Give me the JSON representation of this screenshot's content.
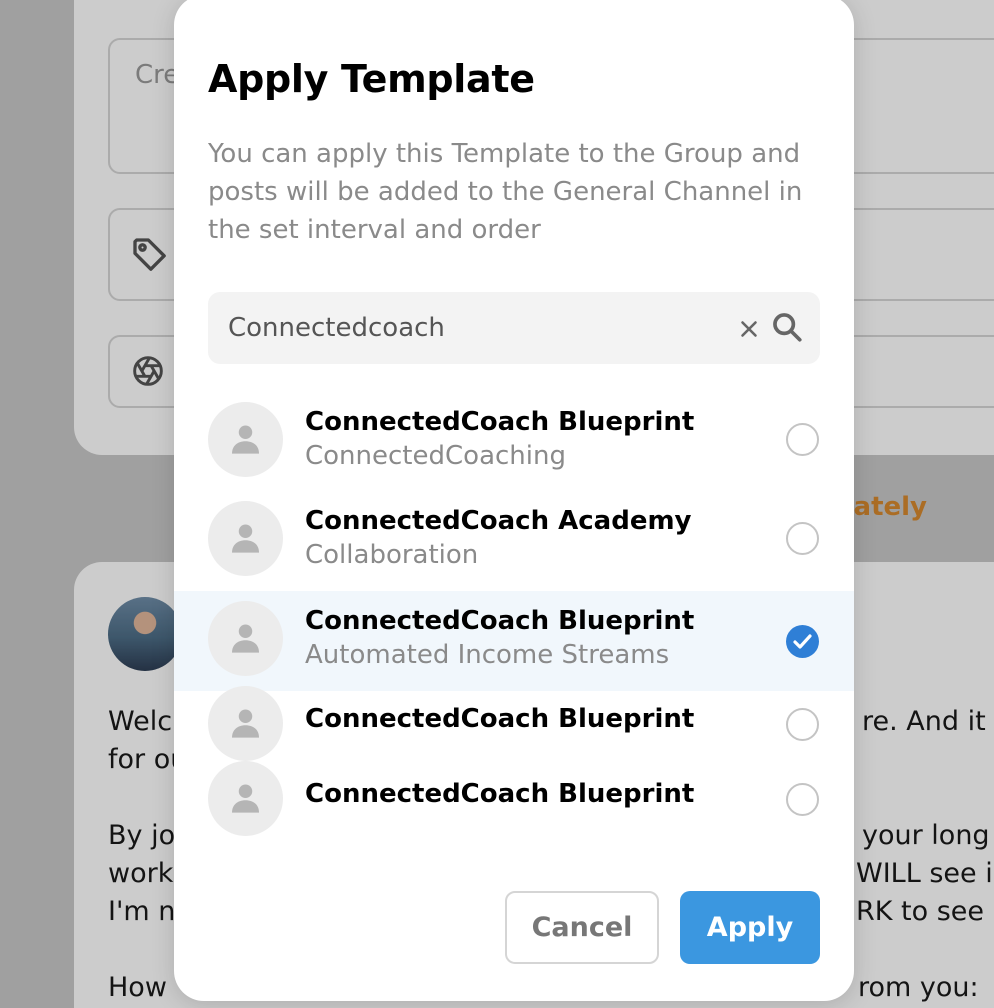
{
  "background": {
    "create_placeholder": "Cre",
    "orange_text": "diately",
    "post_lines": [
      "Welc",
      "for ou",
      "By jo",
      "work",
      "I'm n",
      "How"
    ],
    "post_right_lines": [
      "re. And it w",
      "your long",
      "WILL see i",
      "RK to see",
      "rom you:"
    ]
  },
  "modal": {
    "title": "Apply Template",
    "description": "You can apply this Template to the Group and posts will be added to the General Channel in the set interval and order",
    "search": {
      "value": "Connectedcoach",
      "placeholder": "Search"
    },
    "items": [
      {
        "title": "ConnectedCoach Blueprint",
        "subtitle": "ConnectedCoaching",
        "selected": false
      },
      {
        "title": "ConnectedCoach Academy",
        "subtitle": "Collaboration",
        "selected": false
      },
      {
        "title": "ConnectedCoach Blueprint",
        "subtitle": "Automated Income Streams",
        "selected": true
      },
      {
        "title": "ConnectedCoach Blueprint",
        "subtitle": "",
        "selected": false
      },
      {
        "title": "ConnectedCoach Blueprint",
        "subtitle": "",
        "selected": false
      }
    ],
    "cancel_label": "Cancel",
    "apply_label": "Apply"
  },
  "colors": {
    "accent": "#3b97e0",
    "check": "#2f7fd6",
    "selected_row": "#f1f7fc",
    "muted_text": "#8a8a8a",
    "warning_text": "#d6892f"
  }
}
